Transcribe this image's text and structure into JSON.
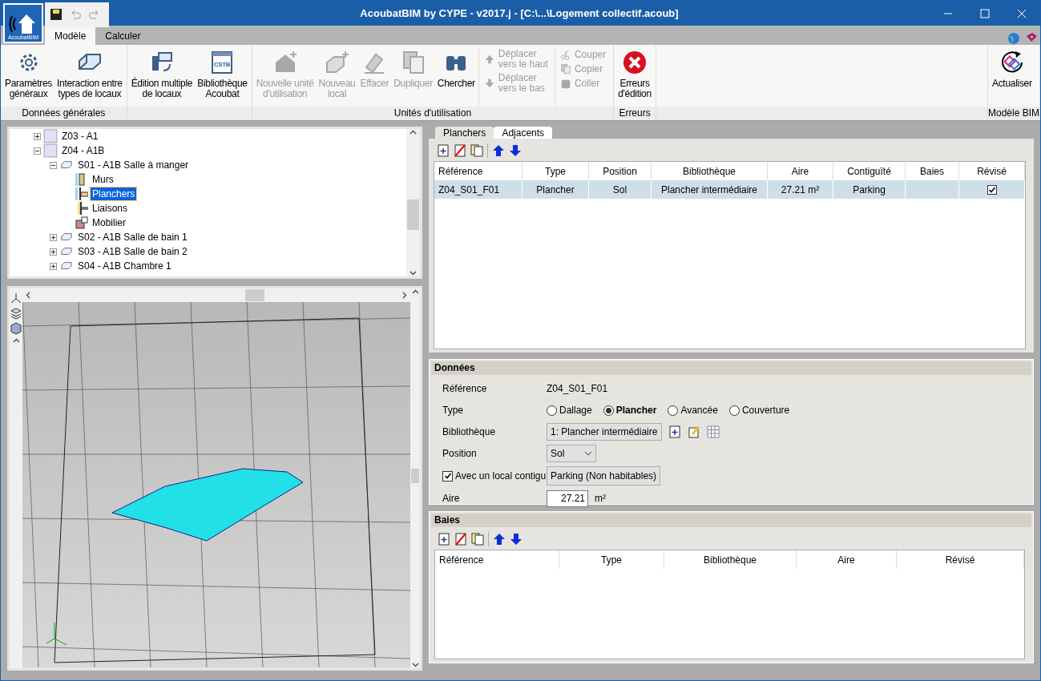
{
  "window": {
    "title": "AcoubatBIM by CYPE - v2017.j - [C:\\...\\Logement collectif.acoub]",
    "logo_text": "AcoubatBIM"
  },
  "ribbon": {
    "tabs": [
      {
        "label": "Modèle",
        "selected": true
      },
      {
        "label": "Calculer",
        "selected": false
      }
    ],
    "groups": [
      {
        "label": "Données générales",
        "items": [
          {
            "kind": "large",
            "label": "Paramètres\ngénéraux",
            "disabled": false
          },
          {
            "kind": "large",
            "label": "Interaction entre\ntypes de locaux",
            "disabled": false
          }
        ]
      },
      {
        "items": [
          {
            "kind": "large",
            "label": "Édition multiple\nde locaux",
            "disabled": false
          },
          {
            "kind": "large",
            "label": "Bibliothèque\nAcoubat",
            "disabled": false,
            "badge": "CSTB"
          }
        ]
      },
      {
        "label": "Unités d'utilisation",
        "items": [
          {
            "kind": "large",
            "label": "Nouvelle unité\nd'utilisation",
            "disabled": true
          },
          {
            "kind": "large",
            "label": "Nouveau\nlocal",
            "disabled": true
          },
          {
            "kind": "large",
            "label": "Effacer",
            "disabled": true
          },
          {
            "kind": "large",
            "label": "Dupliquer",
            "disabled": true
          },
          {
            "kind": "large",
            "label": "Chercher",
            "disabled": false
          },
          {
            "kind": "stack",
            "buttons": [
              {
                "label": "Déplacer\nvers le haut",
                "disabled": true
              },
              {
                "label": "Déplacer\nvers le bas",
                "disabled": true
              }
            ]
          },
          {
            "kind": "stack",
            "buttons": [
              {
                "label": "Couper",
                "disabled": true
              },
              {
                "label": "Copier",
                "disabled": true
              },
              {
                "label": "Coller",
                "disabled": true
              }
            ]
          }
        ]
      },
      {
        "label": "Erreurs",
        "items": [
          {
            "kind": "large",
            "label": "Erreurs\nd'édition",
            "disabled": false
          }
        ]
      },
      {
        "label": "Modèle BIM",
        "items": [
          {
            "kind": "large",
            "label": "Actualiser",
            "disabled": false
          }
        ]
      }
    ]
  },
  "tree": [
    {
      "kind": "zone",
      "label": "Z03 - A1",
      "expanded": false,
      "selected": false
    },
    {
      "kind": "zone",
      "label": "Z04 - A1B",
      "expanded": true,
      "selected": false,
      "children": [
        {
          "kind": "space",
          "label": "S01 - A1B Salle à manger",
          "expanded": true,
          "selected": false,
          "children": [
            {
              "kind": "walls",
              "label": "Murs",
              "selected": false
            },
            {
              "kind": "floors",
              "label": "Planchers",
              "selected": true
            },
            {
              "kind": "links",
              "label": "Liaisons",
              "selected": false
            },
            {
              "kind": "furniture",
              "label": "Mobilier",
              "selected": false
            }
          ]
        },
        {
          "kind": "space",
          "label": "S02 - A1B Salle de bain 1",
          "expanded": false,
          "selected": false
        },
        {
          "kind": "space",
          "label": "S03 - A1B Salle de bain 2",
          "expanded": false,
          "selected": false
        },
        {
          "kind": "space",
          "label": "S04 - A1B Chambre 1",
          "expanded": false,
          "selected": false
        }
      ]
    }
  ],
  "panel": {
    "tabs": [
      {
        "label": "Planchers",
        "selected": true
      },
      {
        "label": "Adjacents",
        "selected": false
      }
    ],
    "table": {
      "columns": [
        "Référence",
        "Type",
        "Position",
        "Bibliothèque",
        "Aire",
        "Contiguïté",
        "Baies",
        "Révisé"
      ],
      "rows": [
        {
          "selected": true,
          "cells": [
            "Z04_S01_F01",
            "Plancher",
            "Sol",
            "Plancher intermédiaire",
            "27.21 m²",
            "Parking",
            ""
          ],
          "revised": true
        }
      ]
    }
  },
  "donnees": {
    "title": "Données",
    "reference": {
      "label": "Référence",
      "value": "Z04_S01_F01"
    },
    "type": {
      "label": "Type",
      "options": [
        {
          "label": "Dallage",
          "selected": false
        },
        {
          "label": "Plancher",
          "selected": true
        },
        {
          "label": "Avancée",
          "selected": false
        },
        {
          "label": "Couverture",
          "selected": false
        }
      ]
    },
    "bibliotheque": {
      "label": "Bibliothèque",
      "value": "1: Plancher intermédiaire"
    },
    "position": {
      "label": "Position",
      "value": "Sol"
    },
    "contigu": {
      "label": "Avec un local contigu",
      "checked": true,
      "button": "Parking (Non habitables)"
    },
    "aire": {
      "label": "Aire",
      "value": "27.21",
      "unit": "m²"
    }
  },
  "baies": {
    "title": "Baies",
    "columns": [
      "Référence",
      "Type",
      "Bibliothèque",
      "Aire",
      "Révisé"
    ]
  }
}
